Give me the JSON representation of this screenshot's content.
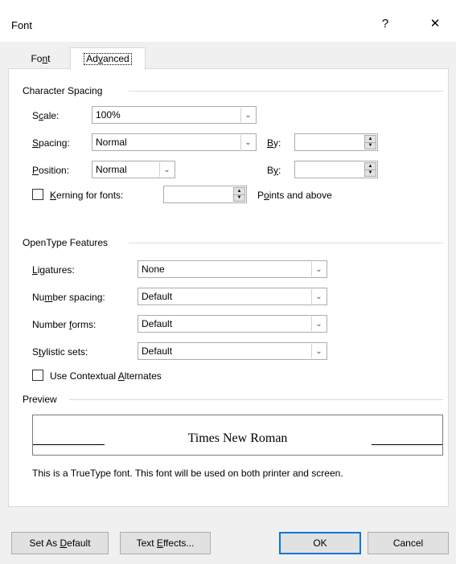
{
  "window": {
    "title": "Font",
    "help_label": "?",
    "close_label": "✕"
  },
  "tabs": [
    {
      "label": "Font",
      "active": false
    },
    {
      "label": "Advanced",
      "active": true
    }
  ],
  "character_spacing": {
    "heading": "Character Spacing",
    "scale_label": "Scale:",
    "scale_value": "100%",
    "spacing_label": "Spacing:",
    "spacing_value": "Normal",
    "spacing_by_label": "By:",
    "spacing_by_value": "",
    "position_label": "Position:",
    "position_value": "Normal",
    "position_by_label": "By:",
    "position_by_value": "",
    "kerning_label": "Kerning for fonts:",
    "kerning_checked": false,
    "kerning_value": "",
    "kerning_suffix": "Points and above"
  },
  "opentype": {
    "heading": "OpenType Features",
    "ligatures_label": "Ligatures:",
    "ligatures_value": "None",
    "number_spacing_label": "Number spacing:",
    "number_spacing_value": "Default",
    "number_forms_label": "Number forms:",
    "number_forms_value": "Default",
    "stylistic_sets_label": "Stylistic sets:",
    "stylistic_sets_value": "Default",
    "contextual_label": "Use Contextual Alternates",
    "contextual_checked": false
  },
  "preview": {
    "heading": "Preview",
    "sample": "Times New Roman",
    "description": "This is a TrueType font. This font will be used on both printer and screen."
  },
  "buttons": {
    "set_default": "Set As Default",
    "text_effects": "Text Effects...",
    "ok": "OK",
    "cancel": "Cancel"
  },
  "icons": {
    "dropdown": "chevron-down-icon",
    "spin_up": "triangle-up-icon",
    "spin_down": "triangle-down-icon"
  },
  "colors": {
    "accent": "#0078d7",
    "dialog_bg": "#f0f0f0",
    "panel_bg": "#ffffff"
  }
}
